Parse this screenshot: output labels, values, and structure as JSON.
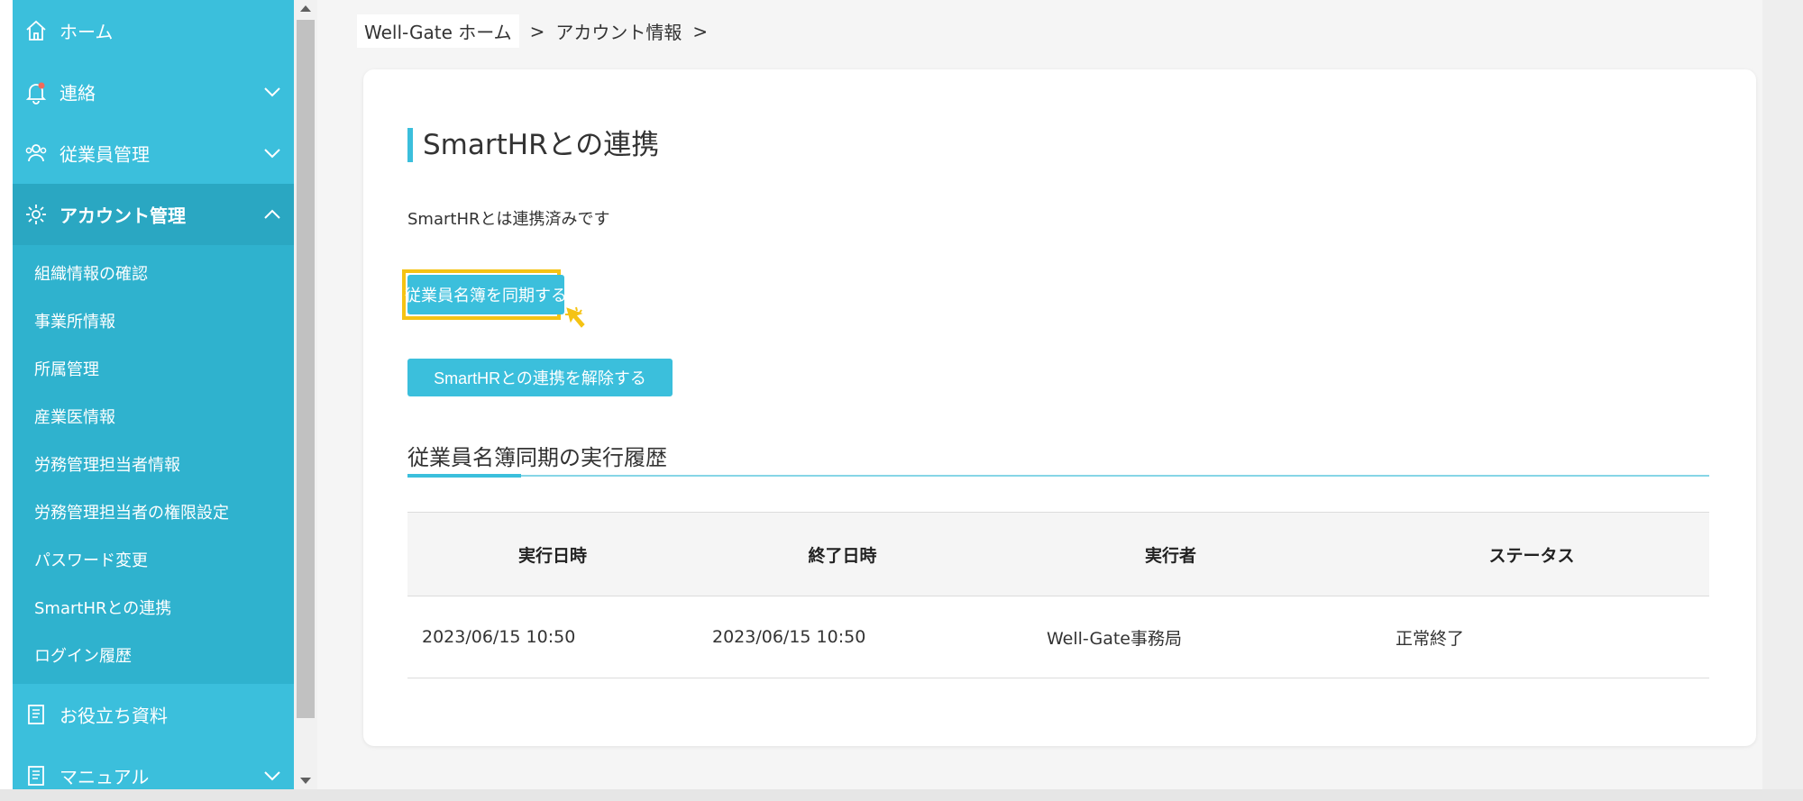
{
  "sidebar": {
    "home": "ホーム",
    "contact": "連絡",
    "employees": "従業員管理",
    "account": "アカウント管理",
    "account_sub": [
      "組織情報の確認",
      "事業所情報",
      "所属管理",
      "産業医情報",
      "労務管理担当者情報",
      "労務管理担当者の権限設定",
      "パスワード変更",
      "SmartHRとの連携",
      "ログイン履歴"
    ],
    "resources": "お役立ち資料",
    "manual": "マニュアル"
  },
  "breadcrumb": {
    "home": "Well-Gate ホーム",
    "sep1": ">",
    "current": "アカウント情報",
    "sep2": ">"
  },
  "main": {
    "title": "SmartHRとの連携",
    "status_text": "SmartHRとは連携済みです",
    "sync_button": "従業員名簿を同期する",
    "unlink_button": "SmartHRとの連携を解除する",
    "history_title": "従業員名簿同期の実行履歴"
  },
  "table": {
    "headers": [
      "実行日時",
      "終了日時",
      "実行者",
      "ステータス"
    ],
    "rows": [
      [
        "2023/06/15 10:50",
        "2023/06/15 10:50",
        "Well-Gate事務局",
        "正常終了"
      ]
    ]
  },
  "colors": {
    "accent": "#3bbfdc",
    "highlight": "#f5c314"
  }
}
